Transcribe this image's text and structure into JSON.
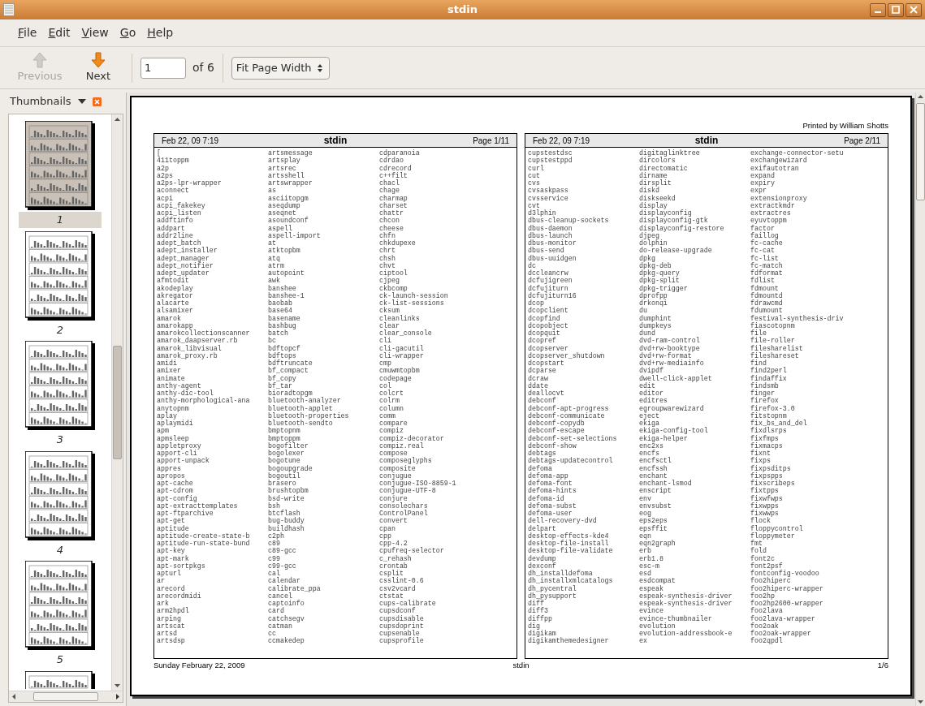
{
  "window": {
    "title": "stdin"
  },
  "menu": [
    "File",
    "Edit",
    "View",
    "Go",
    "Help"
  ],
  "toolbar": {
    "previous": {
      "label": "Previous",
      "disabled": true
    },
    "next": {
      "label": "Next",
      "disabled": false
    },
    "page_value": "1",
    "page_of": "of 6",
    "zoom": "Fit Page Width"
  },
  "sidebar": {
    "title": "Thumbnails",
    "thumbnails": [
      {
        "label": "1",
        "selected": true
      },
      {
        "label": "2",
        "selected": false
      },
      {
        "label": "3",
        "selected": false
      },
      {
        "label": "4",
        "selected": false
      },
      {
        "label": "5",
        "selected": false
      }
    ]
  },
  "document": {
    "printed_by": "Printed by William Shotts",
    "footer_left": "Sunday February 22, 2009",
    "footer_center": "stdin",
    "footer_right": "1/6",
    "sheets": [
      {
        "date": "Feb 22, 09 7:19",
        "title": "stdin",
        "page": "Page 1/11",
        "columns": [
          [
            "[",
            "411toppm",
            "a2p",
            "a2ps",
            "a2ps-lpr-wrapper",
            "aconnect",
            "acpi",
            "acpi_fakekey",
            "acpi_listen",
            "addftinfo",
            "addpart",
            "addr2line",
            "adept_batch",
            "adept_installer",
            "adept_manager",
            "adept_notifier",
            "adept_updater",
            "afmtodit",
            "akodeplay",
            "akregator",
            "alacarte",
            "alsamixer",
            "amarok",
            "amarokapp",
            "amarokcollectionscanner",
            "amarok_daapserver.rb",
            "amarok_libvisual",
            "amarok_proxy.rb",
            "amidi",
            "amixer",
            "animate",
            "anthy-agent",
            "anthy-dic-tool",
            "anthy-morphological-ana",
            "anytopnm",
            "aplay",
            "aplaymidi",
            "apm",
            "apmsleep",
            "appletproxy",
            "apport-cli",
            "apport-unpack",
            "appres",
            "apropos",
            "apt-cache",
            "apt-cdrom",
            "apt-config",
            "apt-extracttemplates",
            "apt-ftparchive",
            "apt-get",
            "aptitude",
            "aptitude-create-state-b",
            "aptitude-run-state-bund",
            "apt-key",
            "apt-mark",
            "apt-sortpkgs",
            "apturl",
            "ar",
            "arecord",
            "arecordmidi",
            "ark",
            "arm2hpdl",
            "arping",
            "artscat",
            "artsd",
            "artsdsp"
          ],
          [
            "artsmessage",
            "artsplay",
            "artsrec",
            "artsshell",
            "artswrapper",
            "as",
            "asciitopgm",
            "aseqdump",
            "aseqnet",
            "asoundconf",
            "aspell",
            "aspell-import",
            "at",
            "atktopbm",
            "atq",
            "atrm",
            "autopoint",
            "awk",
            "banshee",
            "banshee-1",
            "baobab",
            "base64",
            "basename",
            "bashbug",
            "batch",
            "bc",
            "bdftopcf",
            "bdftops",
            "bdftruncate",
            "bf_compact",
            "bf_copy",
            "bf_tar",
            "bioradtopgm",
            "bluetooth-analyzer",
            "bluetooth-applet",
            "bluetooth-properties",
            "bluetooth-sendto",
            "bmptopnm",
            "bmptoppm",
            "bogofilter",
            "bogolexer",
            "bogotune",
            "bogoupgrade",
            "bogoutil",
            "brasero",
            "brushtopbm",
            "bsd-write",
            "bsh",
            "btcflash",
            "bug-buddy",
            "buildhash",
            "c2ph",
            "c89",
            "c89-gcc",
            "c99",
            "c99-gcc",
            "cal",
            "calendar",
            "calibrate_ppa",
            "cancel",
            "captoinfo",
            "card",
            "catchsegv",
            "catman",
            "cc",
            "ccmakedep"
          ],
          [
            "cdparanoia",
            "cdrdao",
            "cdrecord",
            "c++filt",
            "chacl",
            "chage",
            "charmap",
            "charset",
            "chattr",
            "chcon",
            "cheese",
            "chfn",
            "chkdupexe",
            "chrt",
            "chsh",
            "chvt",
            "ciptool",
            "cjpeg",
            "ckbcomp",
            "ck-launch-session",
            "ck-list-sessions",
            "cksum",
            "cleanlinks",
            "clear",
            "clear_console",
            "cli",
            "cli-gacutil",
            "cli-wrapper",
            "cmp",
            "cmuwmtopbm",
            "codepage",
            "col",
            "colcrt",
            "colrm",
            "column",
            "comm",
            "compare",
            "compiz",
            "compiz-decorator",
            "compiz.real",
            "compose",
            "composeglyphs",
            "composite",
            "conjugue",
            "conjugue-ISO-8859-1",
            "conjugue-UTF-8",
            "conjure",
            "consolechars",
            "ControlPanel",
            "convert",
            "cpan",
            "cpp",
            "cpp-4.2",
            "cpufreq-selector",
            "c_rehash",
            "crontab",
            "csplit",
            "csslint-0.6",
            "csv2vcard",
            "ctstat",
            "cups-calibrate",
            "cupsdconf",
            "cupsdisable",
            "cupsdoprint",
            "cupsenable",
            "cupsprofile"
          ]
        ]
      },
      {
        "date": "Feb 22, 09 7:19",
        "title": "stdin",
        "page": "Page 2/11",
        "columns": [
          [
            "cupstestdsc",
            "cupstestppd",
            "curl",
            "cut",
            "cvs",
            "cvsaskpass",
            "cvsservice",
            "cvt",
            "d3lphin",
            "dbus-cleanup-sockets",
            "dbus-daemon",
            "dbus-launch",
            "dbus-monitor",
            "dbus-send",
            "dbus-uuidgen",
            "dc",
            "dccleancrw",
            "dcfujigreen",
            "dcfujiturn",
            "dcfujiturn16",
            "dcop",
            "dcopclient",
            "dcopfind",
            "dcopobject",
            "dcopquit",
            "dcopref",
            "dcopserver",
            "dcopserver_shutdown",
            "dcopstart",
            "dcparse",
            "dcraw",
            "ddate",
            "deallocvt",
            "debconf",
            "debconf-apt-progress",
            "debconf-communicate",
            "debconf-copydb",
            "debconf-escape",
            "debconf-set-selections",
            "debconf-show",
            "debtags",
            "debtags-updatecontrol",
            "defoma",
            "defoma-app",
            "defoma-font",
            "defoma-hints",
            "defoma-id",
            "defoma-subst",
            "defoma-user",
            "dell-recovery-dvd",
            "delpart",
            "desktop-effects-kde4",
            "desktop-file-install",
            "desktop-file-validate",
            "devdump",
            "dexconf",
            "dh_installdefoma",
            "dh_installxmlcatalogs",
            "dh_pycentral",
            "dh_pysupport",
            "diff",
            "diff3",
            "diffpp",
            "dig",
            "digikam",
            "digikamthemedesigner"
          ],
          [
            "digitaglinktree",
            "dircolors",
            "directomatic",
            "dirname",
            "dirsplit",
            "diskd",
            "diskseekd",
            "display",
            "displayconfig",
            "displayconfig-gtk",
            "displayconfig-restore",
            "djpeg",
            "dolphin",
            "do-release-upgrade",
            "dpkg",
            "dpkg-deb",
            "dpkg-query",
            "dpkg-split",
            "dpkg-trigger",
            "dprofpp",
            "drkonqi",
            "du",
            "dumphint",
            "dumpkeys",
            "dund",
            "dvd-ram-control",
            "dvd+rw-booktype",
            "dvd+rw-format",
            "dvd+rw-mediainfo",
            "dvipdf",
            "dwell-click-applet",
            "edit",
            "editor",
            "editres",
            "egroupwarewizard",
            "eject",
            "ekiga",
            "ekiga-config-tool",
            "ekiga-helper",
            "enc2xs",
            "encfs",
            "encfsctl",
            "encfssh",
            "enchant",
            "enchant-lsmod",
            "enscript",
            "env",
            "envsubst",
            "eog",
            "eps2eps",
            "epsffit",
            "eqn",
            "eqn2graph",
            "erb",
            "erb1.8",
            "esc-m",
            "esd",
            "esdcompat",
            "espeak",
            "espeak-synthesis-driver",
            "espeak-synthesis-driver",
            "evince",
            "evince-thumbnailer",
            "evolution",
            "evolution-addressbook-e",
            "ex"
          ],
          [
            "exchange-connector-setu",
            "exchangewizard",
            "exifautotran",
            "expand",
            "expiry",
            "expr",
            "extensionproxy",
            "extractkmdr",
            "extractres",
            "eyuvtoppm",
            "factor",
            "faillog",
            "fc-cache",
            "fc-cat",
            "fc-list",
            "fc-match",
            "fdformat",
            "fdlist",
            "fdmount",
            "fdmountd",
            "fdrawcmd",
            "fdumount",
            "festival-synthesis-driv",
            "fiascotopnm",
            "file",
            "file-roller",
            "filesharelist",
            "fileshareset",
            "find",
            "find2perl",
            "findaffix",
            "findsmb",
            "finger",
            "firefox",
            "firefox-3.0",
            "fitstopnm",
            "fix_bs_and_del",
            "fixdlsrps",
            "fixfmps",
            "fixmacps",
            "fixnt",
            "fixps",
            "fixpsditps",
            "fixpspps",
            "fixscribeps",
            "fixtpps",
            "fixwfwps",
            "fixwpps",
            "fixwwps",
            "flock",
            "floppycontrol",
            "floppymeter",
            "fmt",
            "fold",
            "font2c",
            "font2psf",
            "fontconfig-voodoo",
            "foo2hiperc",
            "foo2hiperc-wrapper",
            "foo2hp",
            "foo2hp2600-wrapper",
            "foo2lava",
            "foo2lava-wrapper",
            "foo2oak",
            "foo2oak-wrapper",
            "foo2qpdl"
          ]
        ]
      }
    ]
  }
}
